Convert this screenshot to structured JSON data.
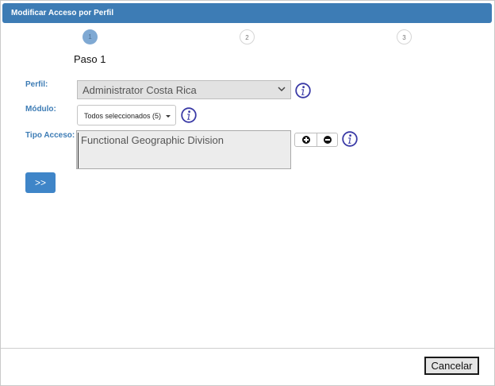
{
  "dialog": {
    "title": "Modificar Acceso por Perfil"
  },
  "steps": {
    "items": [
      {
        "number": "1",
        "state": "active"
      },
      {
        "number": "2",
        "state": "inactive"
      },
      {
        "number": "3",
        "state": "inactive"
      }
    ],
    "current_title": "Paso 1"
  },
  "form": {
    "perfil_label": "Perfil:",
    "perfil_value": "Administrator Costa Rica",
    "modulo_label": "Módulo:",
    "modulo_value": "Todos seleccionados (5)",
    "tipo_label": "Tipo Acceso:",
    "tipo_value": "Functional Geographic Division"
  },
  "icons": {
    "info": "info-icon",
    "add": "plus-circle-icon",
    "remove": "minus-circle-icon",
    "dropdown": "chevron-down-icon"
  },
  "buttons": {
    "next_label": ">>",
    "cancel_label": "Cancelar"
  },
  "colors": {
    "primary": "#3d7cb5",
    "info_icon": "#3a3aa6",
    "step_active": "#7fa9d3",
    "next_button": "#3f85c8"
  }
}
